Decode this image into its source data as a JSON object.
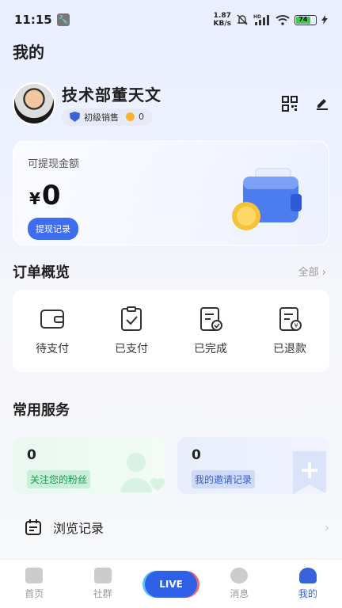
{
  "status": {
    "time": "11:15",
    "net_speed_top": "1.87",
    "net_speed_bottom": "KB/s",
    "hd": "HD",
    "battery": "74"
  },
  "page": {
    "title": "我的"
  },
  "profile": {
    "name": "技术部董天文",
    "level": "初级销售",
    "coins": "0"
  },
  "wallet": {
    "label": "可提现金额",
    "currency": "¥",
    "amount": "0",
    "record_button": "提现记录"
  },
  "orders": {
    "title": "订单概览",
    "all_label": "全部",
    "items": [
      {
        "label": "待支付",
        "icon": "wallet-icon"
      },
      {
        "label": "已支付",
        "icon": "clipboard-check-icon"
      },
      {
        "label": "已完成",
        "icon": "doc-complete-icon"
      },
      {
        "label": "已退款",
        "icon": "doc-refund-icon"
      }
    ]
  },
  "services": {
    "title": "常用服务",
    "fans": {
      "count": "0",
      "label": "关注您的粉丝"
    },
    "invites": {
      "count": "0",
      "label": "我的邀请记录"
    }
  },
  "history": {
    "label": "浏览记录"
  },
  "tabs": [
    {
      "label": "首页",
      "icon": "home-icon"
    },
    {
      "label": "社群",
      "icon": "community-icon"
    },
    {
      "label": "LIVE",
      "icon": "live-icon"
    },
    {
      "label": "消息",
      "icon": "message-icon"
    },
    {
      "label": "我的",
      "icon": "profile-icon"
    }
  ],
  "colors": {
    "accent": "#3b63d9",
    "button": "#3e6df0",
    "fans": "#1d9a55",
    "invite": "#3a5bc7"
  }
}
